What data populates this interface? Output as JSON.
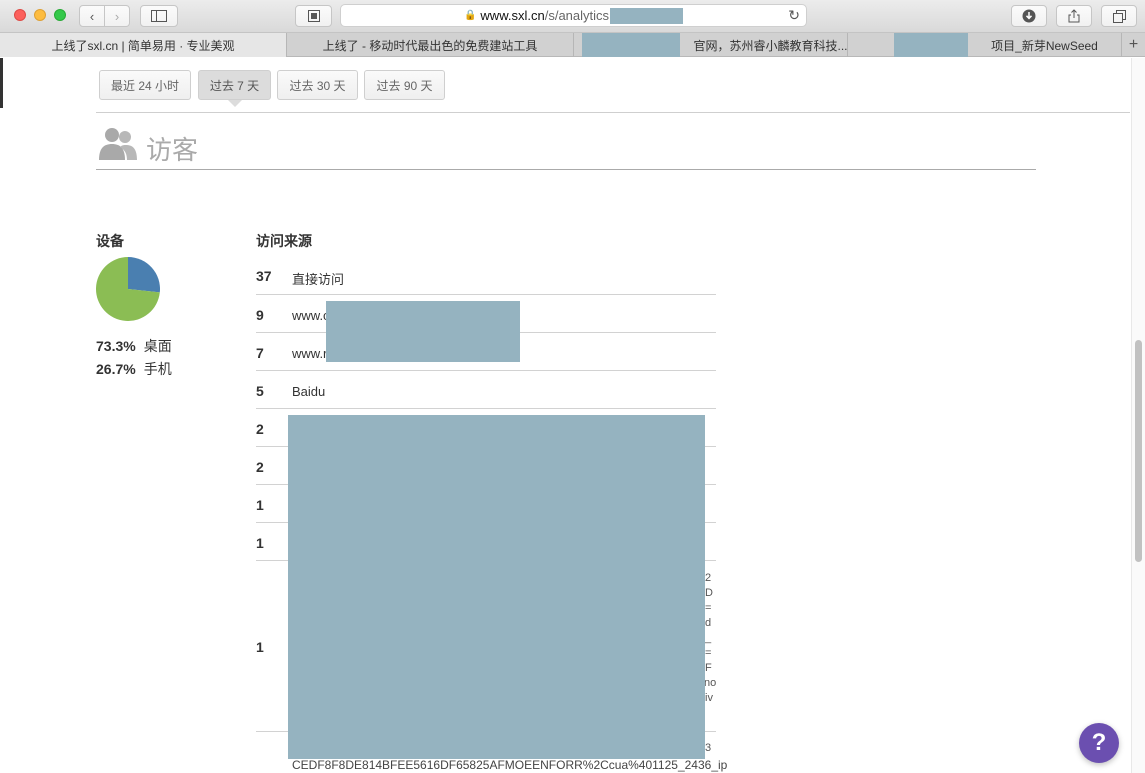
{
  "browser": {
    "url_domain": "www.sxl.cn",
    "url_path": "/s/analytics",
    "tabs": [
      {
        "title": "上线了sxl.cn | 简单易用 · 专业美观"
      },
      {
        "title": "上线了 - 移动时代最出色的免费建站工具"
      },
      {
        "title": "官网，苏州睿小麟教育科技..."
      },
      {
        "title": "项目_新芽NewSeed"
      }
    ],
    "new_tab": "+"
  },
  "range_buttons": [
    "最近 24 小时",
    "过去 7 天",
    "过去 30 天",
    "过去 90 天"
  ],
  "active_range": "过去 7 天",
  "section": {
    "title": "访客"
  },
  "devices": {
    "title": "设备",
    "items": [
      {
        "pct": "73.3%",
        "label": "桌面",
        "value": 73.3,
        "color": "#8bbd54"
      },
      {
        "pct": "26.7%",
        "label": "手机",
        "value": 26.7,
        "color": "#4a7fb0"
      }
    ]
  },
  "referrers": {
    "title": "访问来源",
    "rows": [
      {
        "count": "37",
        "source": "直接访问"
      },
      {
        "count": "9",
        "source": "www.c"
      },
      {
        "count": "7",
        "source": "www.r"
      },
      {
        "count": "5",
        "source": "Baidu"
      },
      {
        "count": "2",
        "source": ""
      },
      {
        "count": "2",
        "source": ""
      },
      {
        "count": "1",
        "source": ""
      },
      {
        "count": "1",
        "source": ""
      },
      {
        "count": "1",
        "source": ""
      }
    ],
    "trailing_fragments": [
      "2",
      "D",
      "=",
      "d",
      "_",
      "=",
      "F",
      "no",
      "iv",
      "3"
    ],
    "long_url_tail": "CEDF8F8DE814BFEE5616DF65825AFMOEENFORR%2Ccua%401125_2436_ip"
  },
  "help_label": "?"
}
